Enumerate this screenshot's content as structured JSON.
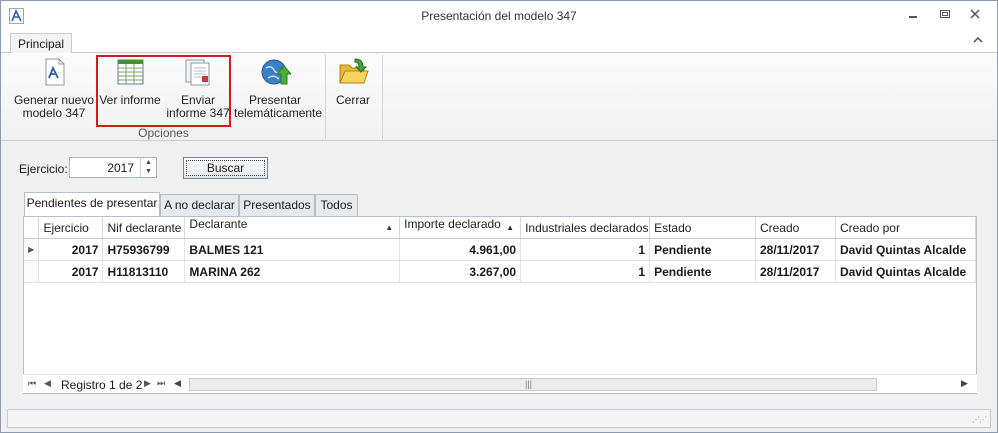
{
  "window": {
    "title": "Presentación del modelo 347"
  },
  "ribbon": {
    "tab": "Principal",
    "buttons": {
      "generar": [
        "Generar nuevo",
        "modelo 347"
      ],
      "ver": [
        "Ver informe"
      ],
      "enviar": [
        "Enviar",
        "informe 347"
      ],
      "presentar": [
        "Presentar",
        "telemáticamente"
      ],
      "cerrar": [
        "Cerrar"
      ]
    },
    "group_caption": "Opciones"
  },
  "filter": {
    "label": "Ejercicio:",
    "year": "2017",
    "search_button": "Buscar"
  },
  "tabs": [
    "Pendientes de presentar",
    "A no declarar",
    "Presentados",
    "Todos"
  ],
  "grid": {
    "columns": [
      "Ejercicio",
      "Nif declarante",
      "Declarante",
      "Importe declarado",
      "Industriales declarados",
      "Estado",
      "Creado",
      "Creado por"
    ],
    "rows": [
      [
        "2017",
        "H75936799",
        "BALMES 121",
        "4.961,00",
        "1",
        "Pendiente",
        "28/11/2017",
        "David Quintas Alcalde"
      ],
      [
        "2017",
        "H11813110",
        "MARINA 262",
        "3.267,00",
        "1",
        "Pendiente",
        "28/11/2017",
        "David Quintas Alcalde"
      ]
    ],
    "record_label": "Registro 1 de 2"
  },
  "colors": {
    "highlight": "#d11b24",
    "titlebar": "#ffffff",
    "ribbon": "#f4f4f4"
  }
}
